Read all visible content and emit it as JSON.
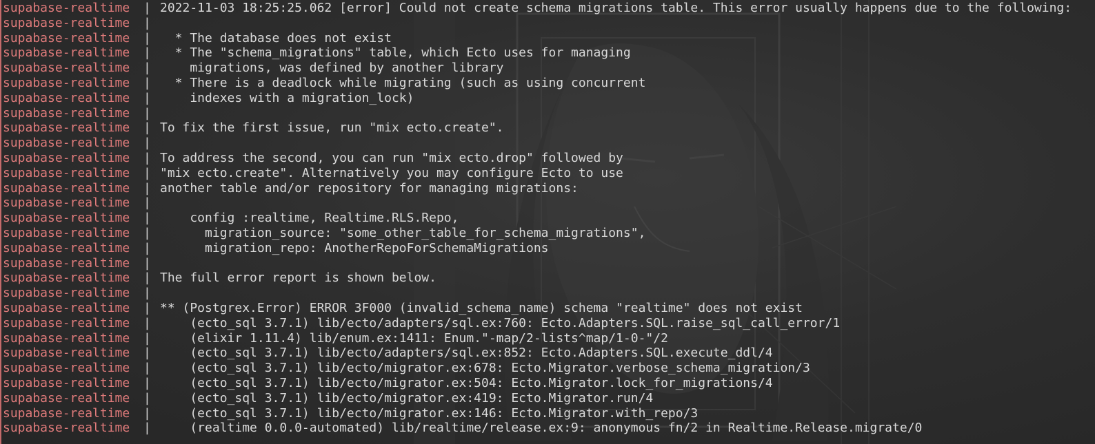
{
  "terminal": {
    "service": "supabase-realtime",
    "separator": "|",
    "lines": [
      "2022-11-03 18:25:25.062 [error] Could not create schema migrations table. This error usually happens due to the following:",
      "",
      "  * The database does not exist",
      "  * The \"schema_migrations\" table, which Ecto uses for managing",
      "    migrations, was defined by another library",
      "  * There is a deadlock while migrating (such as using concurrent",
      "    indexes with a migration_lock)",
      "",
      "To fix the first issue, run \"mix ecto.create\".",
      "",
      "To address the second, you can run \"mix ecto.drop\" followed by",
      "\"mix ecto.create\". Alternatively you may configure Ecto to use",
      "another table and/or repository for managing migrations:",
      "",
      "    config :realtime, Realtime.RLS.Repo,",
      "      migration_source: \"some_other_table_for_schema_migrations\",",
      "      migration_repo: AnotherRepoForSchemaMigrations",
      "",
      "The full error report is shown below.",
      "",
      "** (Postgrex.Error) ERROR 3F000 (invalid_schema_name) schema \"realtime\" does not exist",
      "    (ecto_sql 3.7.1) lib/ecto/adapters/sql.ex:760: Ecto.Adapters.SQL.raise_sql_call_error/1",
      "    (elixir 1.11.4) lib/enum.ex:1411: Enum.\"-map/2-lists^map/1-0-\"/2",
      "    (ecto_sql 3.7.1) lib/ecto/adapters/sql.ex:852: Ecto.Adapters.SQL.execute_ddl/4",
      "    (ecto_sql 3.7.1) lib/ecto/migrator.ex:678: Ecto.Migrator.verbose_schema_migration/3",
      "    (ecto_sql 3.7.1) lib/ecto/migrator.ex:504: Ecto.Migrator.lock_for_migrations/4",
      "    (ecto_sql 3.7.1) lib/ecto/migrator.ex:419: Ecto.Migrator.run/4",
      "    (ecto_sql 3.7.1) lib/ecto/migrator.ex:146: Ecto.Migrator.with_repo/3",
      "    (realtime 0.0.0-automated) lib/realtime/release.ex:9: anonymous fn/2 in Realtime.Release.migrate/0"
    ]
  },
  "colors": {
    "service": "#e07b7b",
    "text": "#d9d9d9",
    "background": "#2b2b2b"
  }
}
